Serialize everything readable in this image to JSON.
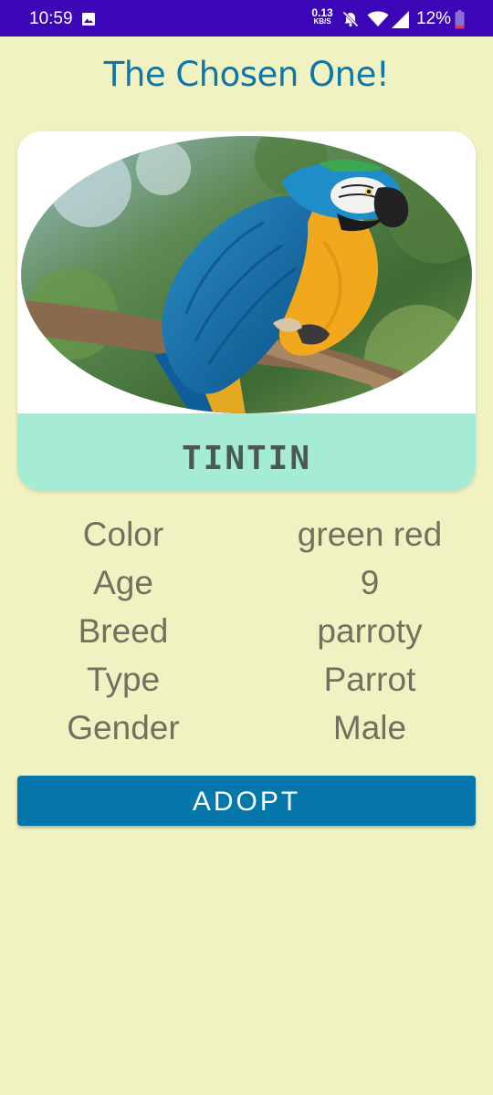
{
  "status_bar": {
    "time": "10:59",
    "net_speed_value": "0.13",
    "net_speed_unit": "KB/S",
    "battery": "12%",
    "icons": [
      "image-icon",
      "mute-icon",
      "wifi-icon",
      "signal-icon",
      "battery-icon"
    ]
  },
  "page": {
    "title": "The Chosen One!"
  },
  "pet": {
    "name": "TINTIN",
    "photo_icon": "parrot-photo"
  },
  "details": {
    "rows": [
      {
        "label": "Color",
        "value": "green red"
      },
      {
        "label": "Age",
        "value": "9"
      },
      {
        "label": "Breed",
        "value": "parroty"
      },
      {
        "label": "Type",
        "value": "Parrot"
      },
      {
        "label": "Gender",
        "value": "Male"
      }
    ]
  },
  "actions": {
    "adopt_label": "ADOPT"
  },
  "colors": {
    "background": "#f1f2c1",
    "status_bar": "#3b06b5",
    "title": "#0b77ac",
    "name_banner": "#a6ebd6",
    "button": "#0677ab"
  }
}
